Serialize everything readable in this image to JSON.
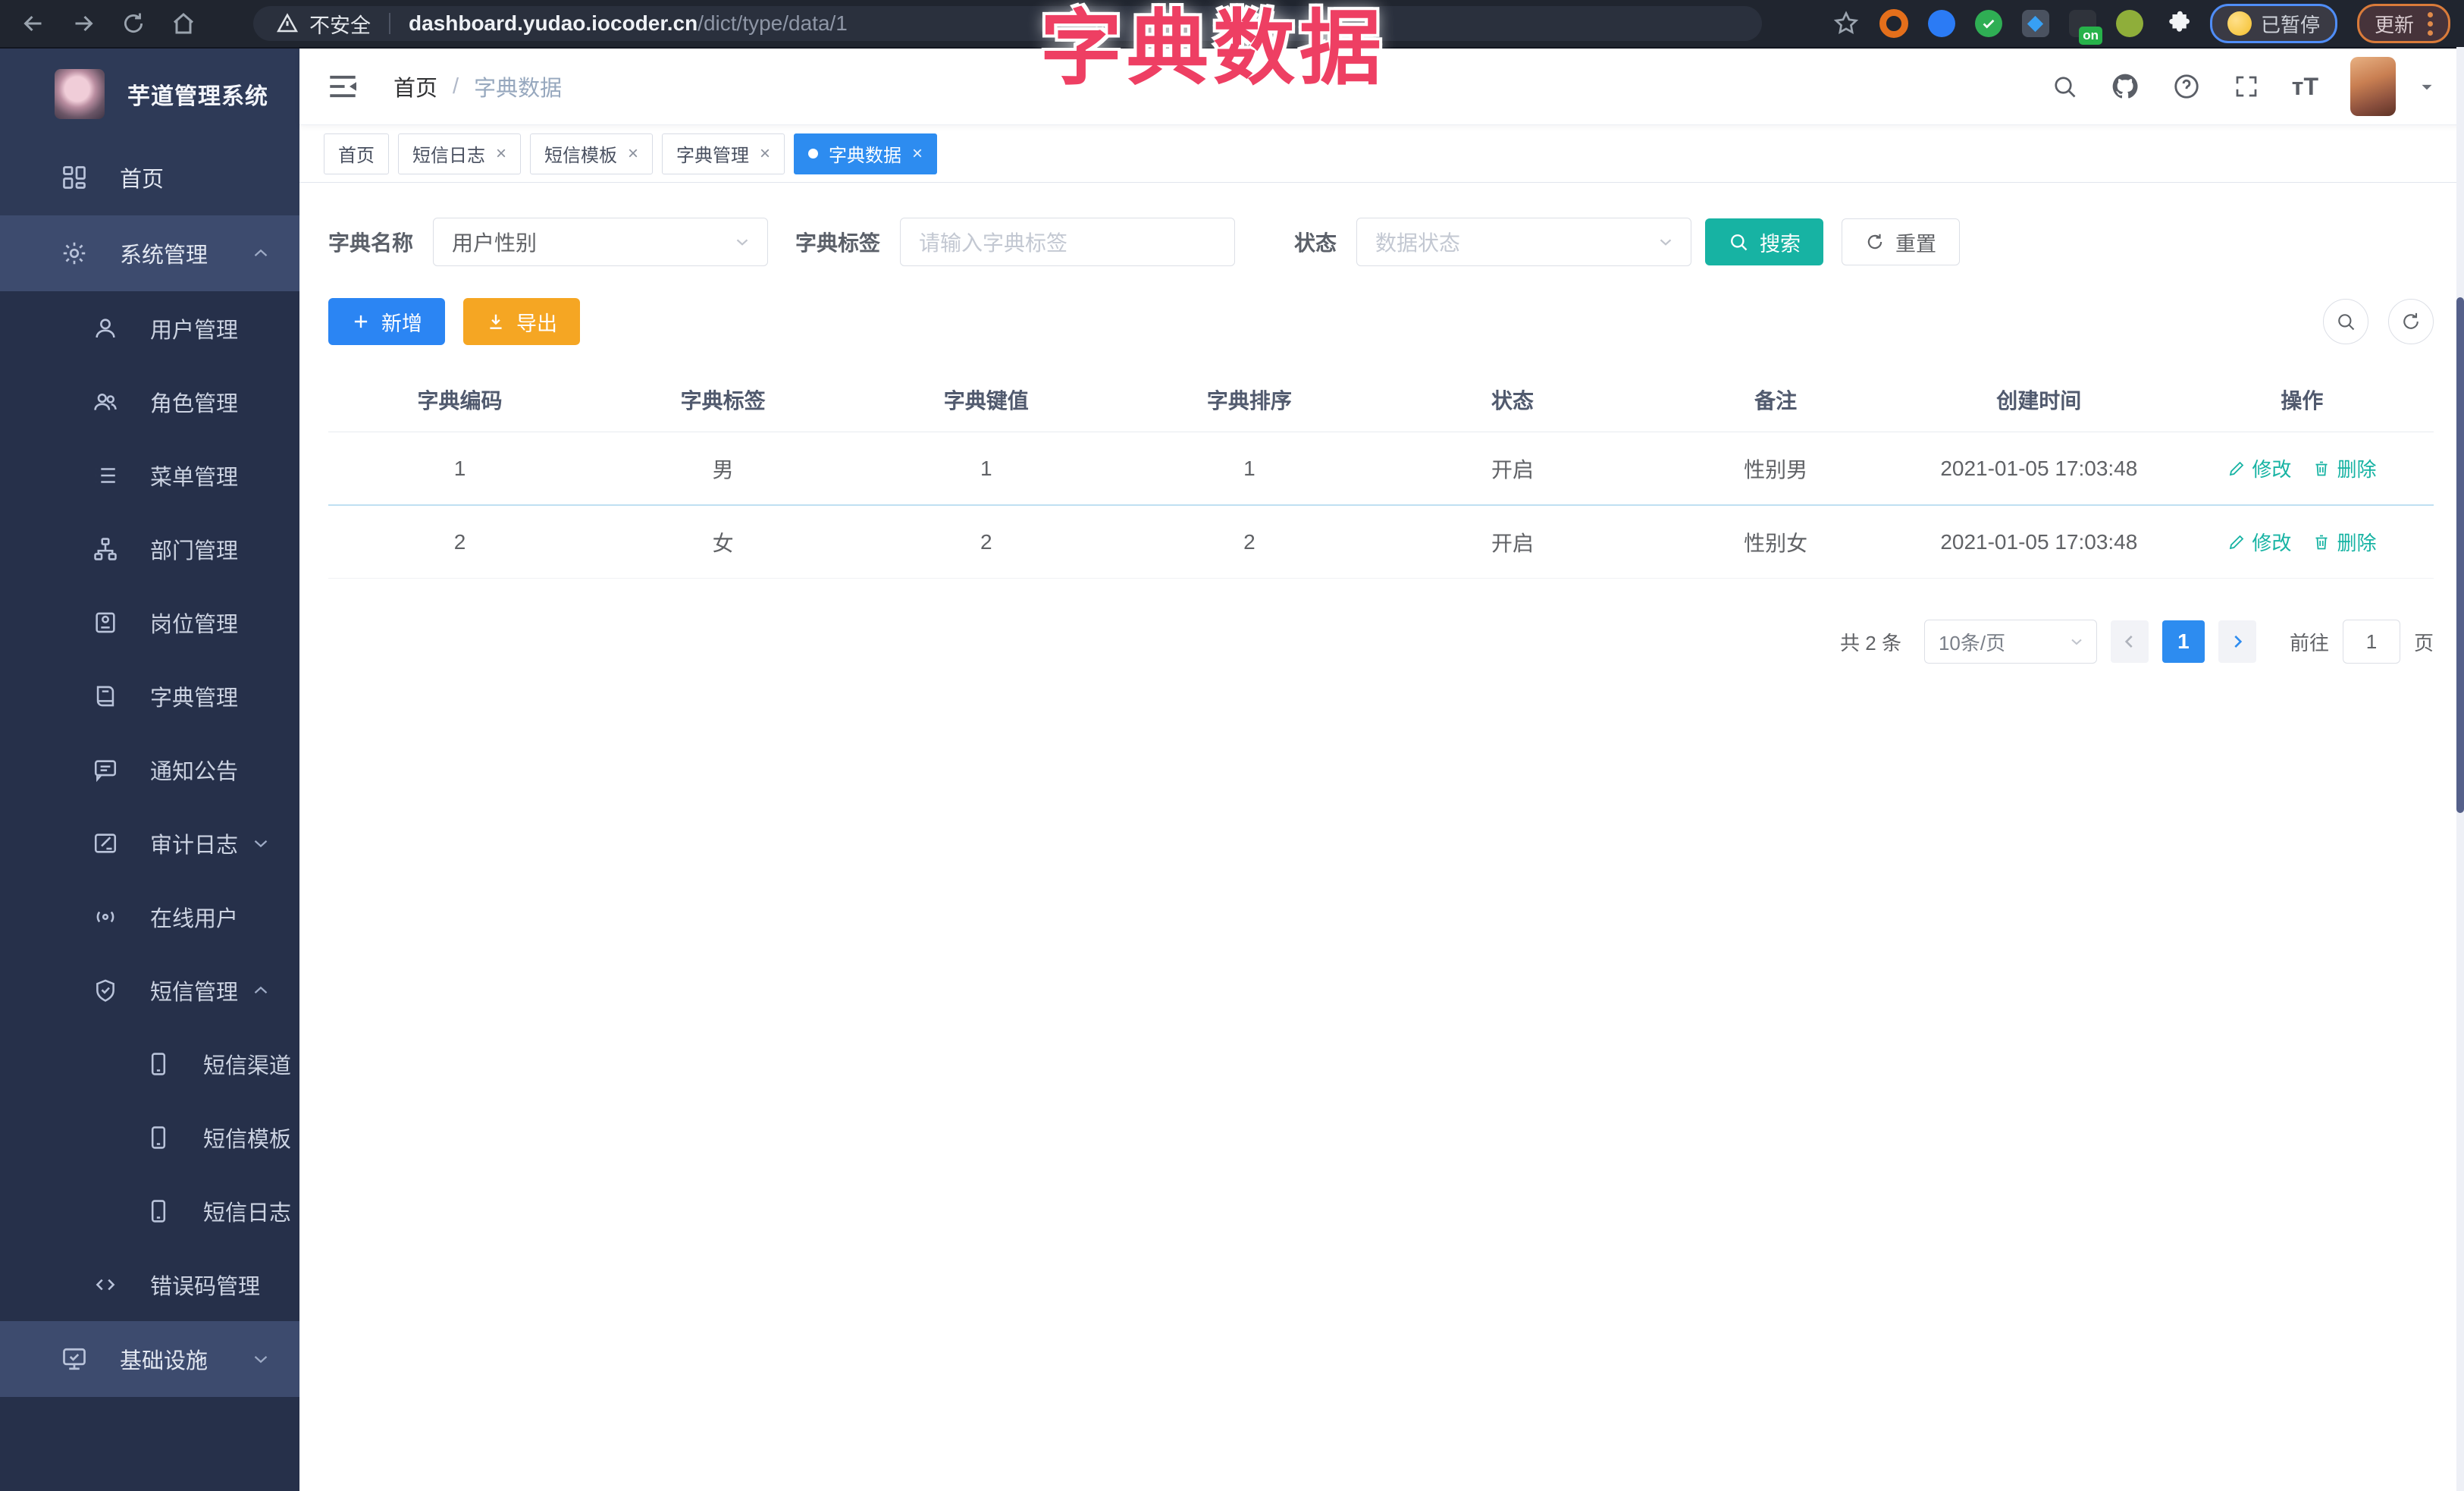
{
  "browser": {
    "security": "不安全",
    "host": "dashboard.yudao.iocoder.cn",
    "path": "/dict/type/data/1",
    "ext_on_badge": "on",
    "paused_label": "已暂停",
    "update_label": "更新"
  },
  "overlay_title": "字典数据",
  "sidebar": {
    "title": "芋道管理系统",
    "home": "首页",
    "system": "系统管理",
    "sub": [
      "用户管理",
      "角色管理",
      "菜单管理",
      "部门管理",
      "岗位管理",
      "字典管理",
      "通知公告",
      "审计日志",
      "在线用户",
      "短信管理",
      "短信渠道",
      "短信模板",
      "短信日志",
      "错误码管理"
    ],
    "infra": "基础设施"
  },
  "navbar": {
    "crumb_home": "首页",
    "crumb_sep": "/",
    "crumb_current": "字典数据",
    "font_icon_glyph": "тT"
  },
  "tabs": {
    "close_glyph": "×",
    "items": [
      "首页",
      "短信日志",
      "短信模板",
      "字典管理",
      "字典数据"
    ]
  },
  "filters": {
    "name_label": "字典名称",
    "name_value": "用户性别",
    "tag_label": "字典标签",
    "tag_placeholder": "请输入字典标签",
    "status_label": "状态",
    "status_placeholder": "数据状态",
    "search_label": "搜索",
    "reset_label": "重置"
  },
  "toolbar": {
    "add_label": "新增",
    "export_label": "导出"
  },
  "table": {
    "columns": [
      "字典编码",
      "字典标签",
      "字典键值",
      "字典排序",
      "状态",
      "备注",
      "创建时间",
      "操作"
    ],
    "rows": [
      [
        "1",
        "男",
        "1",
        "1",
        "开启",
        "性别男",
        "2021-01-05 17:03:48"
      ],
      [
        "2",
        "女",
        "2",
        "2",
        "开启",
        "性别女",
        "2021-01-05 17:03:48"
      ]
    ],
    "edit_label": "修改",
    "delete_label": "删除"
  },
  "pagination": {
    "total": "共 2 条",
    "page_size": "10条/页",
    "page": "1",
    "goto_label": "前往",
    "goto_value": "1",
    "unit_label": "页"
  }
}
